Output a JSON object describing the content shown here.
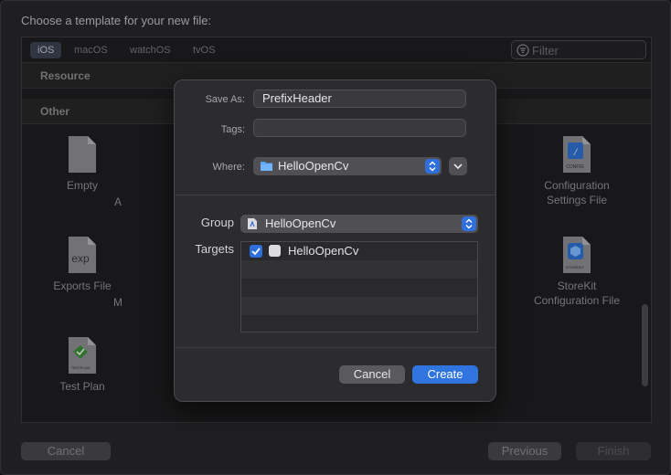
{
  "window": {
    "title": "Choose a template for your new file:"
  },
  "platforms": {
    "tabs": [
      {
        "label": "iOS",
        "active": true
      },
      {
        "label": "macOS",
        "active": false
      },
      {
        "label": "watchOS",
        "active": false
      },
      {
        "label": "tvOS",
        "active": false
      }
    ]
  },
  "filter": {
    "placeholder": "Filter",
    "value": ""
  },
  "sections": {
    "resource": "Resource",
    "other": "Other"
  },
  "templates": {
    "empty": {
      "label": "Empty",
      "icon": "blank-file-icon"
    },
    "exports_file": {
      "label": "Exports File",
      "icon_text": "exp",
      "icon": "exports-file-icon"
    },
    "test_plan": {
      "label": "Test Plan",
      "icon_text": "TESTPLAN",
      "icon": "test-plan-icon"
    },
    "configuration_settings": {
      "label": "Configuration\nSettings File",
      "icon_text": "CONFIG",
      "icon": "config-file-icon"
    },
    "storekit_configuration": {
      "label": "StoreKit\nConfiguration File",
      "icon_text": "STOREKIT",
      "icon": "storekit-file-icon"
    },
    "partial_a": {
      "label": "A"
    },
    "partial_m": {
      "label": "M"
    }
  },
  "footer": {
    "cancel": "Cancel",
    "previous": "Previous",
    "finish": "Finish"
  },
  "save_sheet": {
    "save_as_label": "Save As:",
    "save_as_value": "PrefixHeader",
    "tags_label": "Tags:",
    "tags_value": "",
    "where_label": "Where:",
    "where_value": "HelloOpenCv",
    "group_label": "Group",
    "group_value": "HelloOpenCv",
    "targets_label": "Targets",
    "targets": [
      {
        "name": "HelloOpenCv",
        "checked": true
      }
    ],
    "cancel": "Cancel",
    "create": "Create"
  },
  "colors": {
    "accent": "#2f74df",
    "window_bg": "#27272a",
    "sheet_bg": "#2c2c2f"
  }
}
